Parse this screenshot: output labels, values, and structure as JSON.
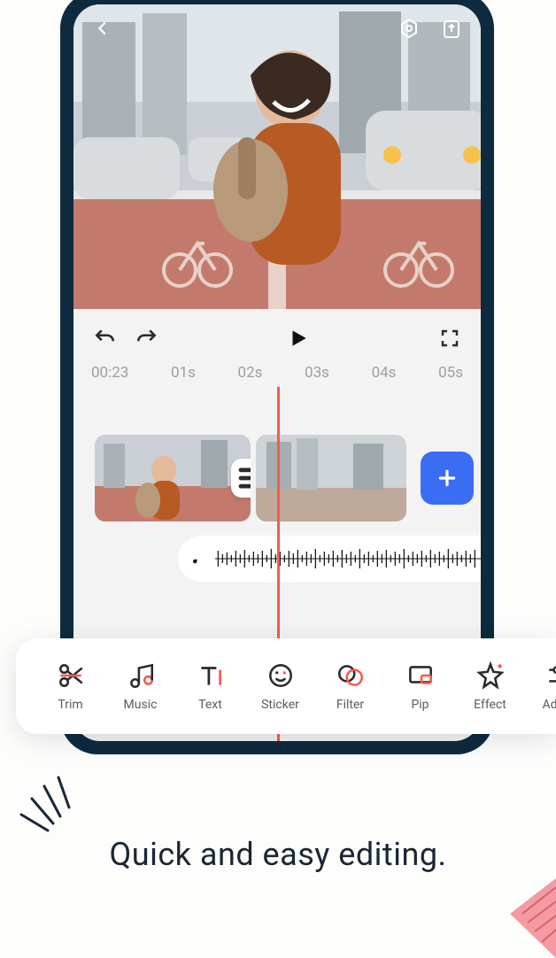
{
  "headline": "Quick and easy editing.",
  "player": {
    "current_time": "00:23"
  },
  "timeline": {
    "ticks": [
      "01s",
      "02s",
      "03s",
      "04s",
      "05s"
    ]
  },
  "toolbar": [
    {
      "label": "Trim",
      "icon": "scissors"
    },
    {
      "label": "Music",
      "icon": "music"
    },
    {
      "label": "Text",
      "icon": "text"
    },
    {
      "label": "Sticker",
      "icon": "sticker"
    },
    {
      "label": "Filter",
      "icon": "filter"
    },
    {
      "label": "Pip",
      "icon": "pip"
    },
    {
      "label": "Effect",
      "icon": "effect"
    },
    {
      "label": "Adjust",
      "icon": "adjust"
    }
  ],
  "colors": {
    "accent_red": "#f25c4c",
    "accent_blue": "#3b6df4",
    "phone_frame": "#0e2a3f"
  }
}
